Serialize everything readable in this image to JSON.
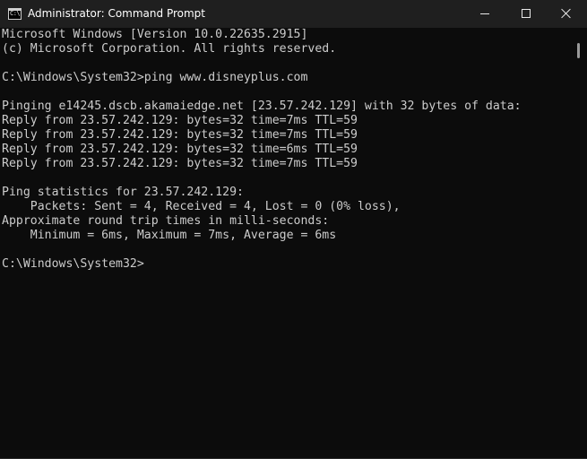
{
  "window": {
    "title": "Administrator: Command Prompt",
    "icon": "cmd-icon",
    "icon_glyph": "C:\\",
    "controls": {
      "minimize": "minimize-icon",
      "maximize": "maximize-icon",
      "close": "close-icon"
    }
  },
  "colors": {
    "background": "#0c0c0c",
    "titlebar": "#1f1f1f",
    "text": "#cccccc"
  },
  "console": {
    "lines": [
      "Microsoft Windows [Version 10.0.22635.2915]",
      "(c) Microsoft Corporation. All rights reserved.",
      "",
      "C:\\Windows\\System32>ping www.disneyplus.com",
      "",
      "Pinging e14245.dscb.akamaiedge.net [23.57.242.129] with 32 bytes of data:",
      "Reply from 23.57.242.129: bytes=32 time=7ms TTL=59",
      "Reply from 23.57.242.129: bytes=32 time=7ms TTL=59",
      "Reply from 23.57.242.129: bytes=32 time=6ms TTL=59",
      "Reply from 23.57.242.129: bytes=32 time=7ms TTL=59",
      "",
      "Ping statistics for 23.57.242.129:",
      "    Packets: Sent = 4, Received = 4, Lost = 0 (0% loss),",
      "Approximate round trip times in milli-seconds:",
      "    Minimum = 6ms, Maximum = 7ms, Average = 6ms",
      "",
      "C:\\Windows\\System32>"
    ]
  }
}
